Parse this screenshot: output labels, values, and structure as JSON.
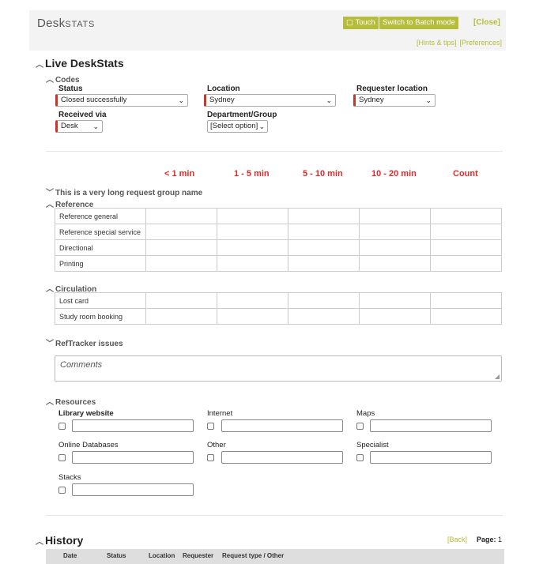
{
  "header": {
    "brand_main": "Desk",
    "brand_sc": "Stats",
    "touch_label": "Touch",
    "batch_label": "Switch to Batch mode",
    "close_label": "[Close]",
    "hints_label": "[Hints & tips]",
    "prefs_label": "[Preferences]"
  },
  "live": {
    "title": "Live DeskStats",
    "codes_title": "Codes",
    "status_label": "Status",
    "status_value": "Closed successfully",
    "location_label": "Location",
    "location_value": "Sydney",
    "requester_label": "Requester location",
    "requester_value": "Sydney",
    "received_label": "Received via",
    "received_value": "Desk",
    "dept_label": "Department/Group",
    "dept_value": "[Select option]"
  },
  "columns": [
    "< 1 min",
    "1 - 5 min",
    "5 - 10 min",
    "10 - 20 min",
    "Count"
  ],
  "groups": {
    "long_group": "This is a very long request group name",
    "reference_title": "Reference",
    "reference_rows": [
      "Reference general",
      "Reference special service",
      "Directional",
      "Printing"
    ],
    "circulation_title": "Circulation",
    "circulation_rows": [
      "Lost card",
      "Study room booking"
    ],
    "reftracker_title": "RefTracker issues"
  },
  "comments_placeholder": "Comments",
  "resources": {
    "title": "Resources",
    "items": [
      "Library website",
      "Internet",
      "Maps",
      "Online Databases",
      "Other",
      "Specialist",
      "Stacks"
    ]
  },
  "history": {
    "title": "History",
    "back_label": "[Back]",
    "page_label": "Page:",
    "page_number": "1",
    "columns": [
      "Date",
      "Status",
      "Location",
      "Requester",
      "Request type / Other"
    ]
  },
  "colors": {
    "accent": "#b5bd3a",
    "required": "#c0392b",
    "column_header": "#e02b2b"
  }
}
